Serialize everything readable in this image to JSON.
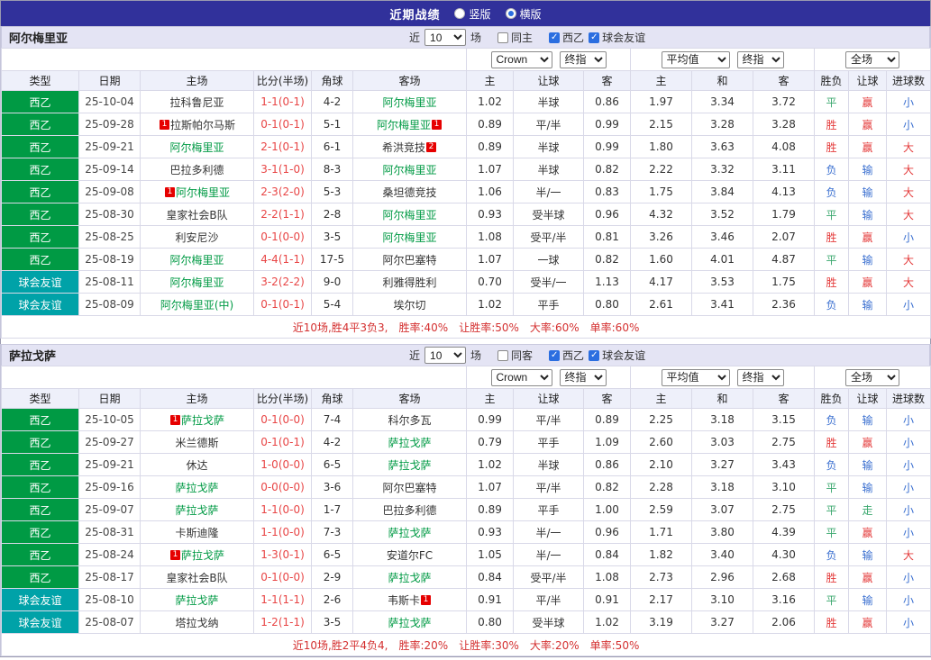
{
  "colors": {
    "navy": "#31319b",
    "panel": "#e4e4f4",
    "header_row": "#eef0fa",
    "border": "#d9d9e8",
    "green": "#009a44",
    "teal": "#00a2a8",
    "score": "#e84545",
    "win": "#e43b3b",
    "lose": "#3a6fd0",
    "draw": "#3aa76d",
    "card": "#e60000",
    "summary": "#d43030",
    "check": "#2b6ee0"
  },
  "topbar": {
    "title": "近期战绩",
    "radios": [
      {
        "label": "竖版",
        "selected": false
      },
      {
        "label": "横版",
        "selected": true
      }
    ]
  },
  "labels": {
    "near": "近",
    "games": "场"
  },
  "selects": {
    "bookmaker": "Crown",
    "stage1": "终指",
    "average": "平均值",
    "stage2": "终指",
    "scope": "全场"
  },
  "columns": {
    "type": "类型",
    "date": "日期",
    "home": "主场",
    "score": "比分(半场)",
    "corner": "角球",
    "away": "客场",
    "h": "主",
    "handicap": "让球",
    "a": "客",
    "avg_h": "主",
    "avg_d": "和",
    "avg_a": "客",
    "result": "胜负",
    "let": "让球",
    "goals": "进球数"
  },
  "sections": [
    {
      "team": "阿尔梅里亚",
      "filter": {
        "count": "10",
        "checks": [
          {
            "label": "同主",
            "checked": false
          },
          {
            "label": "西乙",
            "checked": true
          },
          {
            "label": "球会友谊",
            "checked": true
          }
        ]
      },
      "rows": [
        {
          "league": "西乙",
          "lc": "green",
          "date": "25-10-04",
          "home": {
            "name": "拉科鲁尼亚"
          },
          "score": "1-1(0-1)",
          "corner": "4-2",
          "away": {
            "name": "阿尔梅里亚",
            "focal": true
          },
          "o": [
            "1.02",
            "半球",
            "0.86"
          ],
          "a": [
            "1.97",
            "3.34",
            "3.72"
          ],
          "res": [
            "平",
            "draw"
          ],
          "cov": [
            "赢",
            "win"
          ],
          "gl": [
            "小",
            "lose"
          ]
        },
        {
          "league": "西乙",
          "lc": "green",
          "date": "25-09-28",
          "home": {
            "name": "拉斯帕尔马斯",
            "card_b": "1"
          },
          "score": "0-1(0-1)",
          "corner": "5-1",
          "away": {
            "name": "阿尔梅里亚",
            "focal": true,
            "card_a": "1"
          },
          "o": [
            "0.89",
            "平/半",
            "0.99"
          ],
          "a": [
            "2.15",
            "3.28",
            "3.28"
          ],
          "res": [
            "胜",
            "win"
          ],
          "cov": [
            "赢",
            "win"
          ],
          "gl": [
            "小",
            "lose"
          ]
        },
        {
          "league": "西乙",
          "lc": "green",
          "date": "25-09-21",
          "home": {
            "name": "阿尔梅里亚",
            "focal": true
          },
          "score": "2-1(0-1)",
          "corner": "6-1",
          "away": {
            "name": "希洪竞技",
            "card_a": "2"
          },
          "o": [
            "0.89",
            "半球",
            "0.99"
          ],
          "a": [
            "1.80",
            "3.63",
            "4.08"
          ],
          "res": [
            "胜",
            "win"
          ],
          "cov": [
            "赢",
            "win"
          ],
          "gl": [
            "大",
            "win"
          ]
        },
        {
          "league": "西乙",
          "lc": "green",
          "date": "25-09-14",
          "home": {
            "name": "巴拉多利德"
          },
          "score": "3-1(1-0)",
          "corner": "8-3",
          "away": {
            "name": "阿尔梅里亚",
            "focal": true
          },
          "o": [
            "1.07",
            "半球",
            "0.82"
          ],
          "a": [
            "2.22",
            "3.32",
            "3.11"
          ],
          "res": [
            "负",
            "lose"
          ],
          "cov": [
            "输",
            "lose"
          ],
          "gl": [
            "大",
            "win"
          ]
        },
        {
          "league": "西乙",
          "lc": "green",
          "date": "25-09-08",
          "home": {
            "name": "阿尔梅里亚",
            "focal": true,
            "card_b": "1"
          },
          "score": "2-3(2-0)",
          "corner": "5-3",
          "away": {
            "name": "桑坦德竞技"
          },
          "o": [
            "1.06",
            "半/一",
            "0.83"
          ],
          "a": [
            "1.75",
            "3.84",
            "4.13"
          ],
          "res": [
            "负",
            "lose"
          ],
          "cov": [
            "输",
            "lose"
          ],
          "gl": [
            "大",
            "win"
          ]
        },
        {
          "league": "西乙",
          "lc": "green",
          "date": "25-08-30",
          "home": {
            "name": "皇家社会B队"
          },
          "score": "2-2(1-1)",
          "corner": "2-8",
          "away": {
            "name": "阿尔梅里亚",
            "focal": true
          },
          "o": [
            "0.93",
            "受半球",
            "0.96"
          ],
          "a": [
            "4.32",
            "3.52",
            "1.79"
          ],
          "res": [
            "平",
            "draw"
          ],
          "cov": [
            "输",
            "lose"
          ],
          "gl": [
            "大",
            "win"
          ]
        },
        {
          "league": "西乙",
          "lc": "green",
          "date": "25-08-25",
          "home": {
            "name": "利安尼沙"
          },
          "score": "0-1(0-0)",
          "corner": "3-5",
          "away": {
            "name": "阿尔梅里亚",
            "focal": true
          },
          "o": [
            "1.08",
            "受平/半",
            "0.81"
          ],
          "a": [
            "3.26",
            "3.46",
            "2.07"
          ],
          "res": [
            "胜",
            "win"
          ],
          "cov": [
            "赢",
            "win"
          ],
          "gl": [
            "小",
            "lose"
          ]
        },
        {
          "league": "西乙",
          "lc": "green",
          "date": "25-08-19",
          "home": {
            "name": "阿尔梅里亚",
            "focal": true
          },
          "score": "4-4(1-1)",
          "corner": "17-5",
          "away": {
            "name": "阿尔巴塞特"
          },
          "o": [
            "1.07",
            "一球",
            "0.82"
          ],
          "a": [
            "1.60",
            "4.01",
            "4.87"
          ],
          "res": [
            "平",
            "draw"
          ],
          "cov": [
            "输",
            "lose"
          ],
          "gl": [
            "大",
            "win"
          ]
        },
        {
          "league": "球会友谊",
          "lc": "teal",
          "date": "25-08-11",
          "home": {
            "name": "阿尔梅里亚",
            "focal": true
          },
          "score": "3-2(2-2)",
          "corner": "9-0",
          "away": {
            "name": "利雅得胜利"
          },
          "o": [
            "0.70",
            "受半/一",
            "1.13"
          ],
          "a": [
            "4.17",
            "3.53",
            "1.75"
          ],
          "res": [
            "胜",
            "win"
          ],
          "cov": [
            "赢",
            "win"
          ],
          "gl": [
            "大",
            "win"
          ]
        },
        {
          "league": "球会友谊",
          "lc": "teal",
          "date": "25-08-09",
          "home": {
            "name": "阿尔梅里亚(中)",
            "focal": true
          },
          "score": "0-1(0-1)",
          "corner": "5-4",
          "away": {
            "name": "埃尔切"
          },
          "o": [
            "1.02",
            "平手",
            "0.80"
          ],
          "a": [
            "2.61",
            "3.41",
            "2.36"
          ],
          "res": [
            "负",
            "lose"
          ],
          "cov": [
            "输",
            "lose"
          ],
          "gl": [
            "小",
            "lose"
          ]
        }
      ],
      "summary": "近10场,胜4平3负3,　胜率:40%　让胜率:50%　大率:60%　单率:60%"
    },
    {
      "team": "萨拉戈萨",
      "filter": {
        "count": "10",
        "checks": [
          {
            "label": "同客",
            "checked": false
          },
          {
            "label": "西乙",
            "checked": true
          },
          {
            "label": "球会友谊",
            "checked": true
          }
        ]
      },
      "rows": [
        {
          "league": "西乙",
          "lc": "green",
          "date": "25-10-05",
          "home": {
            "name": "萨拉戈萨",
            "focal": true,
            "card_b": "1"
          },
          "score": "0-1(0-0)",
          "corner": "7-4",
          "away": {
            "name": "科尔多瓦"
          },
          "o": [
            "0.99",
            "平/半",
            "0.89"
          ],
          "a": [
            "2.25",
            "3.18",
            "3.15"
          ],
          "res": [
            "负",
            "lose"
          ],
          "cov": [
            "输",
            "lose"
          ],
          "gl": [
            "小",
            "lose"
          ]
        },
        {
          "league": "西乙",
          "lc": "green",
          "date": "25-09-27",
          "home": {
            "name": "米兰德斯"
          },
          "score": "0-1(0-1)",
          "corner": "4-2",
          "away": {
            "name": "萨拉戈萨",
            "focal": true
          },
          "o": [
            "0.79",
            "平手",
            "1.09"
          ],
          "a": [
            "2.60",
            "3.03",
            "2.75"
          ],
          "res": [
            "胜",
            "win"
          ],
          "cov": [
            "赢",
            "win"
          ],
          "gl": [
            "小",
            "lose"
          ]
        },
        {
          "league": "西乙",
          "lc": "green",
          "date": "25-09-21",
          "home": {
            "name": "休达"
          },
          "score": "1-0(0-0)",
          "corner": "6-5",
          "away": {
            "name": "萨拉戈萨",
            "focal": true
          },
          "o": [
            "1.02",
            "半球",
            "0.86"
          ],
          "a": [
            "2.10",
            "3.27",
            "3.43"
          ],
          "res": [
            "负",
            "lose"
          ],
          "cov": [
            "输",
            "lose"
          ],
          "gl": [
            "小",
            "lose"
          ]
        },
        {
          "league": "西乙",
          "lc": "green",
          "date": "25-09-16",
          "home": {
            "name": "萨拉戈萨",
            "focal": true
          },
          "score": "0-0(0-0)",
          "corner": "3-6",
          "away": {
            "name": "阿尔巴塞特"
          },
          "o": [
            "1.07",
            "平/半",
            "0.82"
          ],
          "a": [
            "2.28",
            "3.18",
            "3.10"
          ],
          "res": [
            "平",
            "draw"
          ],
          "cov": [
            "输",
            "lose"
          ],
          "gl": [
            "小",
            "lose"
          ]
        },
        {
          "league": "西乙",
          "lc": "green",
          "date": "25-09-07",
          "home": {
            "name": "萨拉戈萨",
            "focal": true
          },
          "score": "1-1(0-0)",
          "corner": "1-7",
          "away": {
            "name": "巴拉多利德"
          },
          "o": [
            "0.89",
            "平手",
            "1.00"
          ],
          "a": [
            "2.59",
            "3.07",
            "2.75"
          ],
          "res": [
            "平",
            "draw"
          ],
          "cov": [
            "走",
            "draw"
          ],
          "gl": [
            "小",
            "lose"
          ]
        },
        {
          "league": "西乙",
          "lc": "green",
          "date": "25-08-31",
          "home": {
            "name": "卡斯迪隆"
          },
          "score": "1-1(0-0)",
          "corner": "7-3",
          "away": {
            "name": "萨拉戈萨",
            "focal": true
          },
          "o": [
            "0.93",
            "半/一",
            "0.96"
          ],
          "a": [
            "1.71",
            "3.80",
            "4.39"
          ],
          "res": [
            "平",
            "draw"
          ],
          "cov": [
            "赢",
            "win"
          ],
          "gl": [
            "小",
            "lose"
          ]
        },
        {
          "league": "西乙",
          "lc": "green",
          "date": "25-08-24",
          "home": {
            "name": "萨拉戈萨",
            "focal": true,
            "card_b": "1"
          },
          "score": "1-3(0-1)",
          "corner": "6-5",
          "away": {
            "name": "安道尔FC"
          },
          "o": [
            "1.05",
            "半/一",
            "0.84"
          ],
          "a": [
            "1.82",
            "3.40",
            "4.30"
          ],
          "res": [
            "负",
            "lose"
          ],
          "cov": [
            "输",
            "lose"
          ],
          "gl": [
            "大",
            "win"
          ]
        },
        {
          "league": "西乙",
          "lc": "green",
          "date": "25-08-17",
          "home": {
            "name": "皇家社会B队"
          },
          "score": "0-1(0-0)",
          "corner": "2-9",
          "away": {
            "name": "萨拉戈萨",
            "focal": true
          },
          "o": [
            "0.84",
            "受平/半",
            "1.08"
          ],
          "a": [
            "2.73",
            "2.96",
            "2.68"
          ],
          "res": [
            "胜",
            "win"
          ],
          "cov": [
            "赢",
            "win"
          ],
          "gl": [
            "小",
            "lose"
          ]
        },
        {
          "league": "球会友谊",
          "lc": "teal",
          "date": "25-08-10",
          "home": {
            "name": "萨拉戈萨",
            "focal": true
          },
          "score": "1-1(1-1)",
          "corner": "2-6",
          "away": {
            "name": "韦斯卡",
            "card_a": "1"
          },
          "o": [
            "0.91",
            "平/半",
            "0.91"
          ],
          "a": [
            "2.17",
            "3.10",
            "3.16"
          ],
          "res": [
            "平",
            "draw"
          ],
          "cov": [
            "输",
            "lose"
          ],
          "gl": [
            "小",
            "lose"
          ]
        },
        {
          "league": "球会友谊",
          "lc": "teal",
          "date": "25-08-07",
          "home": {
            "name": "塔拉戈纳"
          },
          "score": "1-2(1-1)",
          "corner": "3-5",
          "away": {
            "name": "萨拉戈萨",
            "focal": true
          },
          "o": [
            "0.80",
            "受半球",
            "1.02"
          ],
          "a": [
            "3.19",
            "3.27",
            "2.06"
          ],
          "res": [
            "胜",
            "win"
          ],
          "cov": [
            "赢",
            "win"
          ],
          "gl": [
            "小",
            "lose"
          ]
        }
      ],
      "summary": "近10场,胜2平4负4,　胜率:20%　让胜率:30%　大率:20%　单率:50%"
    }
  ]
}
